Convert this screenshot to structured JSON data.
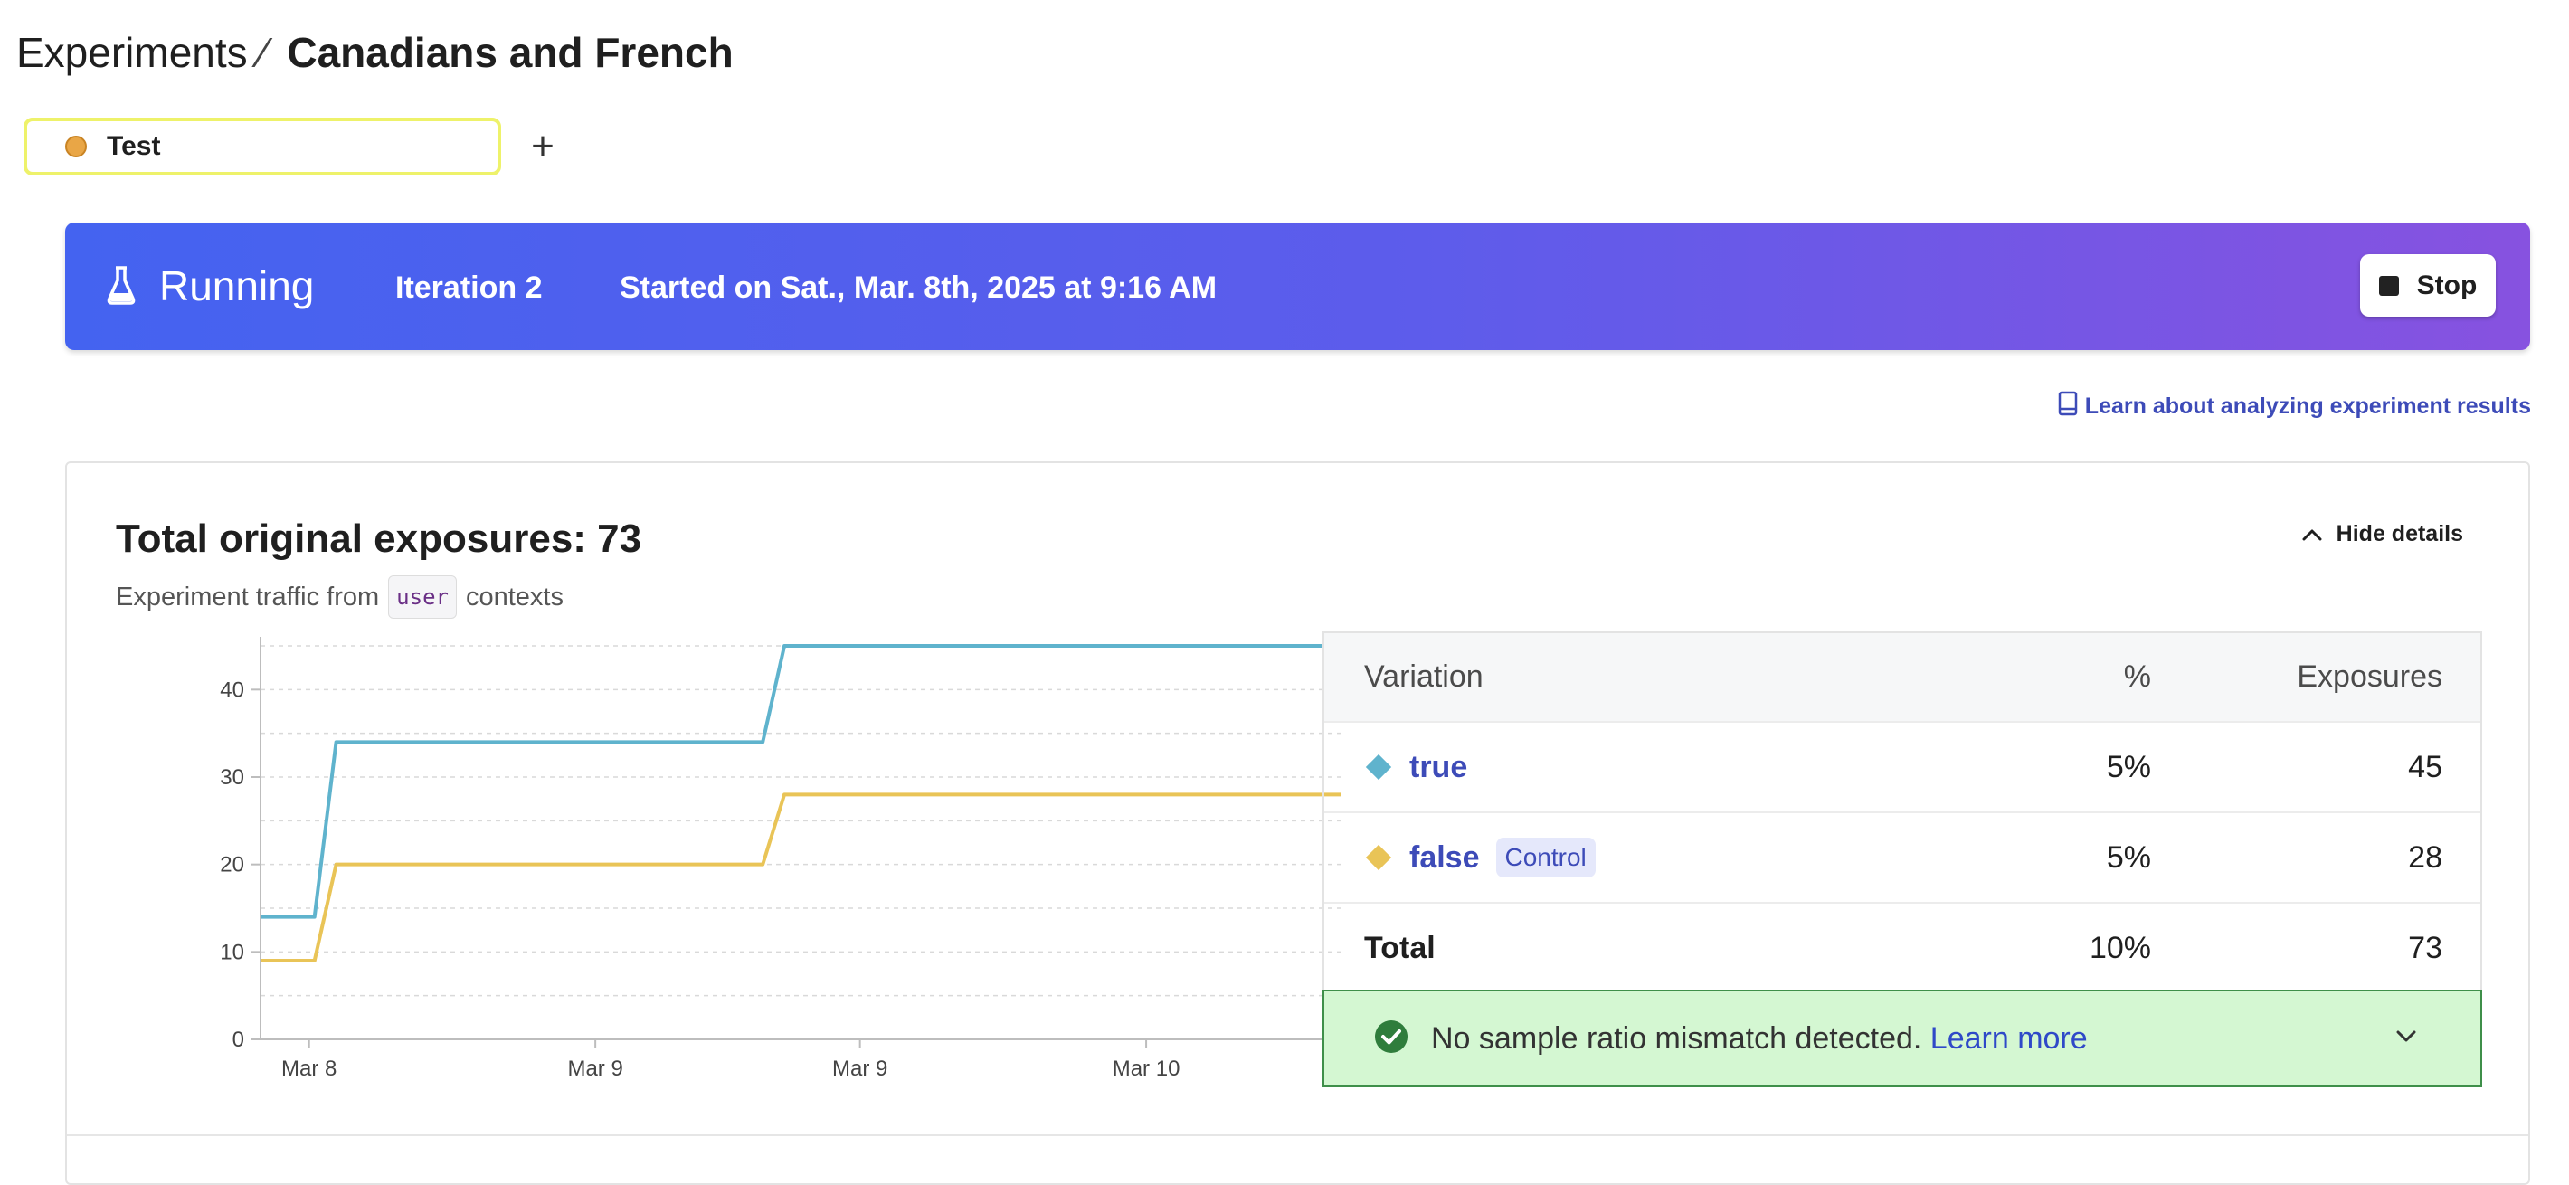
{
  "breadcrumb": {
    "parent": "Experiments",
    "separator": "⁄",
    "current": "Canadians and French"
  },
  "tab": {
    "label": "Test",
    "add_label": "+"
  },
  "banner": {
    "status": "Running",
    "iteration": "Iteration 2",
    "started": "Started on Sat., Mar. 8th, 2025 at 9:16 AM",
    "stop_label": "Stop",
    "colors": {
      "start": "#4463f0",
      "end": "#8752e0"
    }
  },
  "learn_link": "Learn about analyzing experiment results",
  "card": {
    "title": "Total original exposures: 73",
    "subtitle_prefix": "Experiment traffic from",
    "subtitle_code": "user",
    "subtitle_suffix": "contexts",
    "hide_label": "Hide details"
  },
  "table": {
    "headers": {
      "variation": "Variation",
      "percent": "%",
      "exposures": "Exposures"
    },
    "rows": [
      {
        "name": "true",
        "badge": "",
        "percent": "5%",
        "exposures": "45",
        "color": "#5fb3cd"
      },
      {
        "name": "false",
        "badge": "Control",
        "percent": "5%",
        "exposures": "28",
        "color": "#e9c457"
      }
    ],
    "total": {
      "label": "Total",
      "percent": "10%",
      "exposures": "73"
    }
  },
  "srm": {
    "message": "No sample ratio mismatch detected.",
    "link": "Learn more"
  },
  "chart_data": {
    "type": "line",
    "x_tick_labels": [
      "Mar 8",
      "Mar 9",
      "Mar 9",
      "Mar 10"
    ],
    "ylim": [
      0,
      45
    ],
    "y_ticks": [
      0,
      10,
      20,
      30,
      40
    ],
    "grid": true,
    "series": [
      {
        "name": "true",
        "color": "#5fb3cd",
        "x": [
          0,
          0.05,
          0.07,
          0.465,
          0.485,
          1.0
        ],
        "values": [
          14,
          14,
          34,
          34,
          45,
          45
        ]
      },
      {
        "name": "false",
        "color": "#e9c457",
        "x": [
          0,
          0.05,
          0.07,
          0.465,
          0.485,
          1.0
        ],
        "values": [
          9,
          9,
          20,
          20,
          28,
          28
        ]
      }
    ]
  }
}
